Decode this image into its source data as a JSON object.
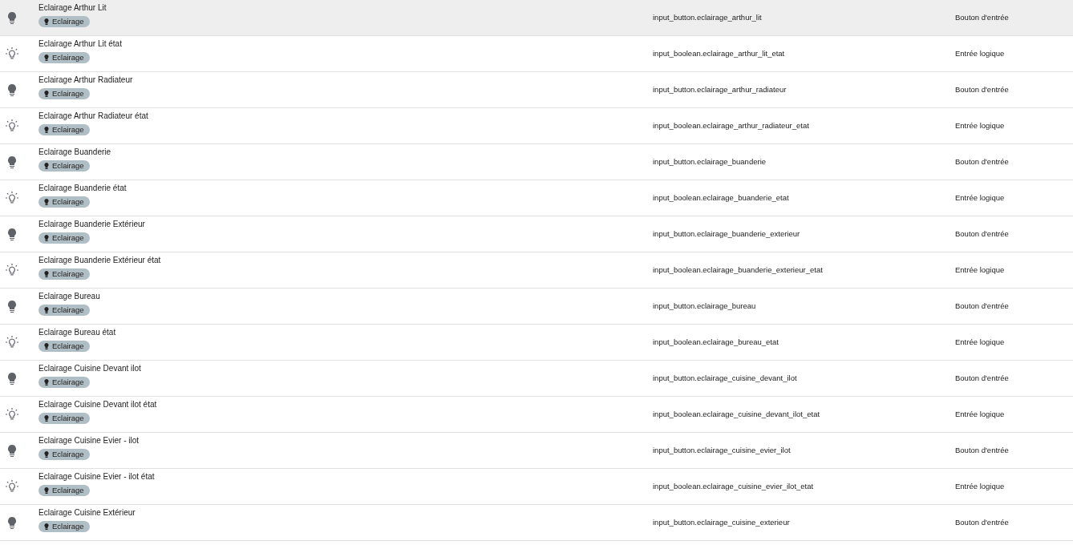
{
  "rows": [
    {
      "kind": "button",
      "hovered": true,
      "name": "Eclairage Arthur Lit",
      "label": "Eclairage",
      "entity_id": "input_button.eclairage_arthur_lit",
      "type": "Bouton d'entrée"
    },
    {
      "kind": "boolean",
      "hovered": false,
      "name": "Eclairage Arthur Lit état",
      "label": "Eclairage",
      "entity_id": "input_boolean.eclairage_arthur_lit_etat",
      "type": "Entrée logique"
    },
    {
      "kind": "button",
      "hovered": false,
      "name": "Eclairage Arthur Radiateur",
      "label": "Eclairage",
      "entity_id": "input_button.eclairage_arthur_radiateur",
      "type": "Bouton d'entrée"
    },
    {
      "kind": "boolean",
      "hovered": false,
      "name": "Eclairage Arthur Radiateur état",
      "label": "Eclairage",
      "entity_id": "input_boolean.eclairage_arthur_radiateur_etat",
      "type": "Entrée logique"
    },
    {
      "kind": "button",
      "hovered": false,
      "name": "Eclairage Buanderie",
      "label": "Eclairage",
      "entity_id": "input_button.eclairage_buanderie",
      "type": "Bouton d'entrée"
    },
    {
      "kind": "boolean",
      "hovered": false,
      "name": "Eclairage Buanderie état",
      "label": "Eclairage",
      "entity_id": "input_boolean.eclairage_buanderie_etat",
      "type": "Entrée logique"
    },
    {
      "kind": "button",
      "hovered": false,
      "name": "Eclairage Buanderie Extérieur",
      "label": "Eclairage",
      "entity_id": "input_button.eclairage_buanderie_exterieur",
      "type": "Bouton d'entrée"
    },
    {
      "kind": "boolean",
      "hovered": false,
      "name": "Eclairage Buanderie Extérieur état",
      "label": "Eclairage",
      "entity_id": "input_boolean.eclairage_buanderie_exterieur_etat",
      "type": "Entrée logique"
    },
    {
      "kind": "button",
      "hovered": false,
      "name": "Eclairage Bureau",
      "label": "Eclairage",
      "entity_id": "input_button.eclairage_bureau",
      "type": "Bouton d'entrée"
    },
    {
      "kind": "boolean",
      "hovered": false,
      "name": "Eclairage Bureau état",
      "label": "Eclairage",
      "entity_id": "input_boolean.eclairage_bureau_etat",
      "type": "Entrée logique"
    },
    {
      "kind": "button",
      "hovered": false,
      "name": "Eclairage Cuisine Devant ilot",
      "label": "Eclairage",
      "entity_id": "input_button.eclairage_cuisine_devant_ilot",
      "type": "Bouton d'entrée"
    },
    {
      "kind": "boolean",
      "hovered": false,
      "name": "Eclairage Cuisine Devant ilot état",
      "label": "Eclairage",
      "entity_id": "input_boolean.eclairage_cuisine_devant_ilot_etat",
      "type": "Entrée logique"
    },
    {
      "kind": "button",
      "hovered": false,
      "name": "Eclairage Cuisine Evier - ilot",
      "label": "Eclairage",
      "entity_id": "input_button.eclairage_cuisine_evier_ilot",
      "type": "Bouton d'entrée"
    },
    {
      "kind": "boolean",
      "hovered": false,
      "name": "Eclairage Cuisine Evier - ilot état",
      "label": "Eclairage",
      "entity_id": "input_boolean.eclairage_cuisine_evier_ilot_etat",
      "type": "Entrée logique"
    },
    {
      "kind": "button",
      "hovered": false,
      "name": "Eclairage Cuisine Extérieur",
      "label": "Eclairage",
      "entity_id": "input_button.eclairage_cuisine_exterieur",
      "type": "Bouton d'entrée"
    }
  ]
}
